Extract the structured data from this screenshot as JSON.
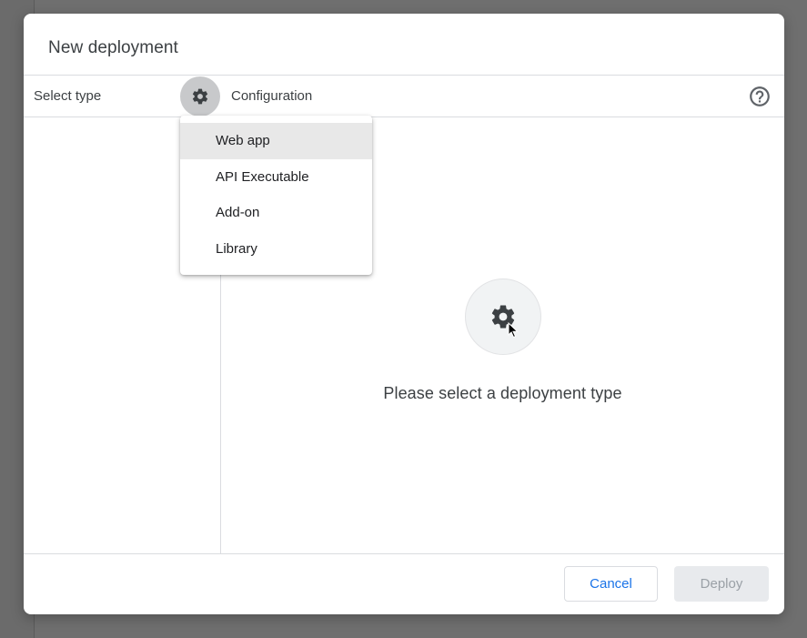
{
  "dialog": {
    "title": "New deployment"
  },
  "header": {
    "select_type_label": "Select type",
    "configuration_label": "Configuration",
    "settings_icon": "gear-icon",
    "help_icon": "help-circle-icon"
  },
  "menu": {
    "items": [
      {
        "label": "Web app",
        "highlighted": true
      },
      {
        "label": "API Executable",
        "highlighted": false
      },
      {
        "label": "Add-on",
        "highlighted": false
      },
      {
        "label": "Library",
        "highlighted": false
      }
    ]
  },
  "empty_state": {
    "icon": "gear-icon",
    "message": "Please select a deployment type"
  },
  "footer": {
    "cancel_label": "Cancel",
    "deploy_label": "Deploy",
    "deploy_disabled": true
  },
  "colors": {
    "accent": "#1a73e8",
    "text": "#3c4043",
    "disabled_text": "#9aa0a6",
    "overlay": "#6f6f6f"
  }
}
